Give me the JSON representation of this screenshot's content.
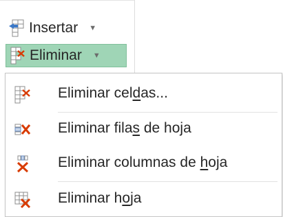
{
  "ribbon": {
    "insert": {
      "label": "Insertar",
      "icon": "insert-cells-icon"
    },
    "delete": {
      "label": "Eliminar",
      "icon": "delete-cells-icon",
      "state": "active"
    },
    "caret": "▼"
  },
  "menu": {
    "items": [
      {
        "id": "delete-cells",
        "icon": "delete-cells-icon",
        "label_parts": [
          "Eliminar cel",
          "d",
          "as..."
        ],
        "full_label": "Eliminar celdas..."
      },
      {
        "id": "delete-sheet-rows",
        "icon": "delete-rows-icon",
        "label_parts": [
          "Eliminar fila",
          "s",
          " de hoja"
        ],
        "full_label": "Eliminar filas de hoja"
      },
      {
        "id": "delete-sheet-columns",
        "icon": "delete-columns-icon",
        "label_parts": [
          "Eliminar columnas de ",
          "h",
          "oja"
        ],
        "full_label": "Eliminar columnas de hoja"
      },
      {
        "id": "delete-sheet",
        "icon": "delete-sheet-icon",
        "label_parts": [
          "Eliminar h",
          "o",
          "ja"
        ],
        "full_label": "Eliminar hoja"
      }
    ]
  },
  "colors": {
    "active_bg": "#9fd5b6",
    "delete_red": "#d83b01",
    "icon_blue": "#3c79c8",
    "icon_gray": "#8c8c8c",
    "text": "#262626"
  }
}
